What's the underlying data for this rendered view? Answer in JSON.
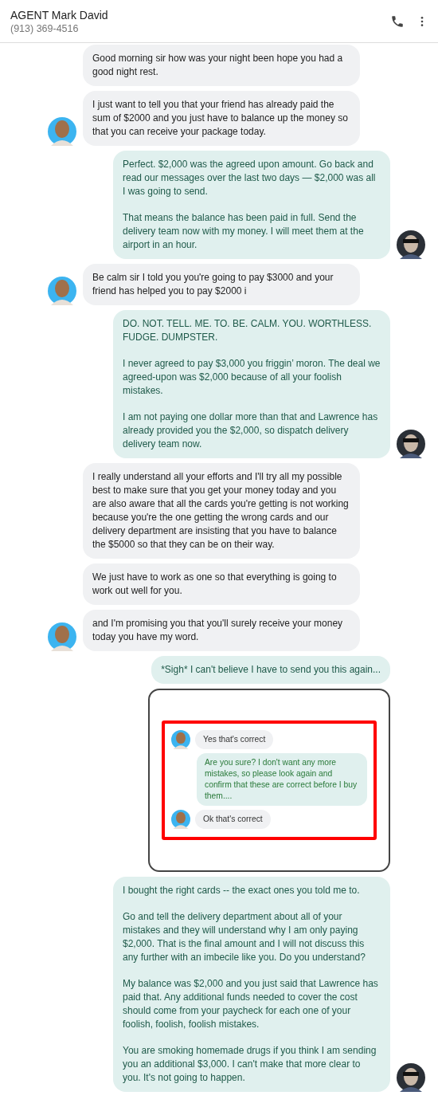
{
  "header": {
    "title": "AGENT Mark David",
    "subtitle": "(913) 369-4516"
  },
  "messages": [
    {
      "kind": "incoming",
      "avatar": false,
      "paragraphs": [
        "Good morning sir how was your night been hope you had a good night rest."
      ]
    },
    {
      "kind": "incoming",
      "avatar": true,
      "paragraphs": [
        "I just want to tell you that your friend has already paid the sum of $2000 and you just have to balance up the money so that you can receive your package today."
      ]
    },
    {
      "kind": "outgoing",
      "avatar": true,
      "paragraphs": [
        "Perfect. $2,000 was the agreed upon amount. Go back and read our messages over the last two days — $2,000 was all I was going to send.",
        "That means the balance has been paid in full. Send the delivery team now with my money. I will meet them at the airport in an hour."
      ]
    },
    {
      "kind": "incoming",
      "avatar": true,
      "paragraphs": [
        "Be calm sir I told you you're going to pay $3000 and your friend has helped you to pay $2000 i"
      ]
    },
    {
      "kind": "outgoing",
      "avatar": true,
      "paragraphs": [
        "DO. NOT. TELL. ME. TO. BE. CALM. YOU. WORTHLESS. FUDGE. DUMPSTER.",
        "I never agreed to pay $3,000 you friggin’ moron. The deal we agreed-upon was $2,000 because of all your foolish mistakes.",
        "I am not paying one dollar more than that and Lawrence has already provided you the $2,000, so dispatch delivery delivery team now."
      ]
    },
    {
      "kind": "incoming",
      "avatar": false,
      "paragraphs": [
        "I really understand all your efforts and I'll try all my possible best to make sure that you get your money today and you are also aware that all the cards you're getting is not working because you're the one getting the wrong cards and our delivery department are insisting that you have to balance the $5000 so that they can be on their way."
      ]
    },
    {
      "kind": "incoming",
      "avatar": false,
      "paragraphs": [
        "We just have to work as one so that everything is going to work out well for you."
      ]
    },
    {
      "kind": "incoming",
      "avatar": true,
      "paragraphs": [
        "and I'm promising you that you'll surely receive your money today you have my word."
      ]
    },
    {
      "kind": "outgoing",
      "avatar": false,
      "paragraphs": [
        "*Sigh* I can't believe I have to send you this again..."
      ]
    },
    {
      "kind": "screenshot",
      "messages": [
        {
          "kind": "incoming",
          "text": "Yes that's correct"
        },
        {
          "kind": "outgoing",
          "text": "Are you sure? I don't want any more mistakes, so please look again and confirm that these are correct before I buy them...."
        },
        {
          "kind": "incoming",
          "text": "Ok that's correct"
        }
      ]
    },
    {
      "kind": "outgoing",
      "avatar": true,
      "paragraphs": [
        "I bought the right cards -- the exact ones you told me to.",
        "Go and tell the delivery department about all of your mistakes and they will understand why I am only paying $2,000. That is the final amount and I will not discuss this any further with an imbecile like you. Do you understand?",
        "My balance was $2,000 and you just said that Lawrence has paid that. Any additional funds needed to cover the cost should come from your paycheck for each one of your foolish, foolish, foolish mistakes.",
        "You are smoking homemade drugs if you think I am sending you an additional $3,000. I can't make that more clear to you. It's not going to happen."
      ]
    }
  ]
}
